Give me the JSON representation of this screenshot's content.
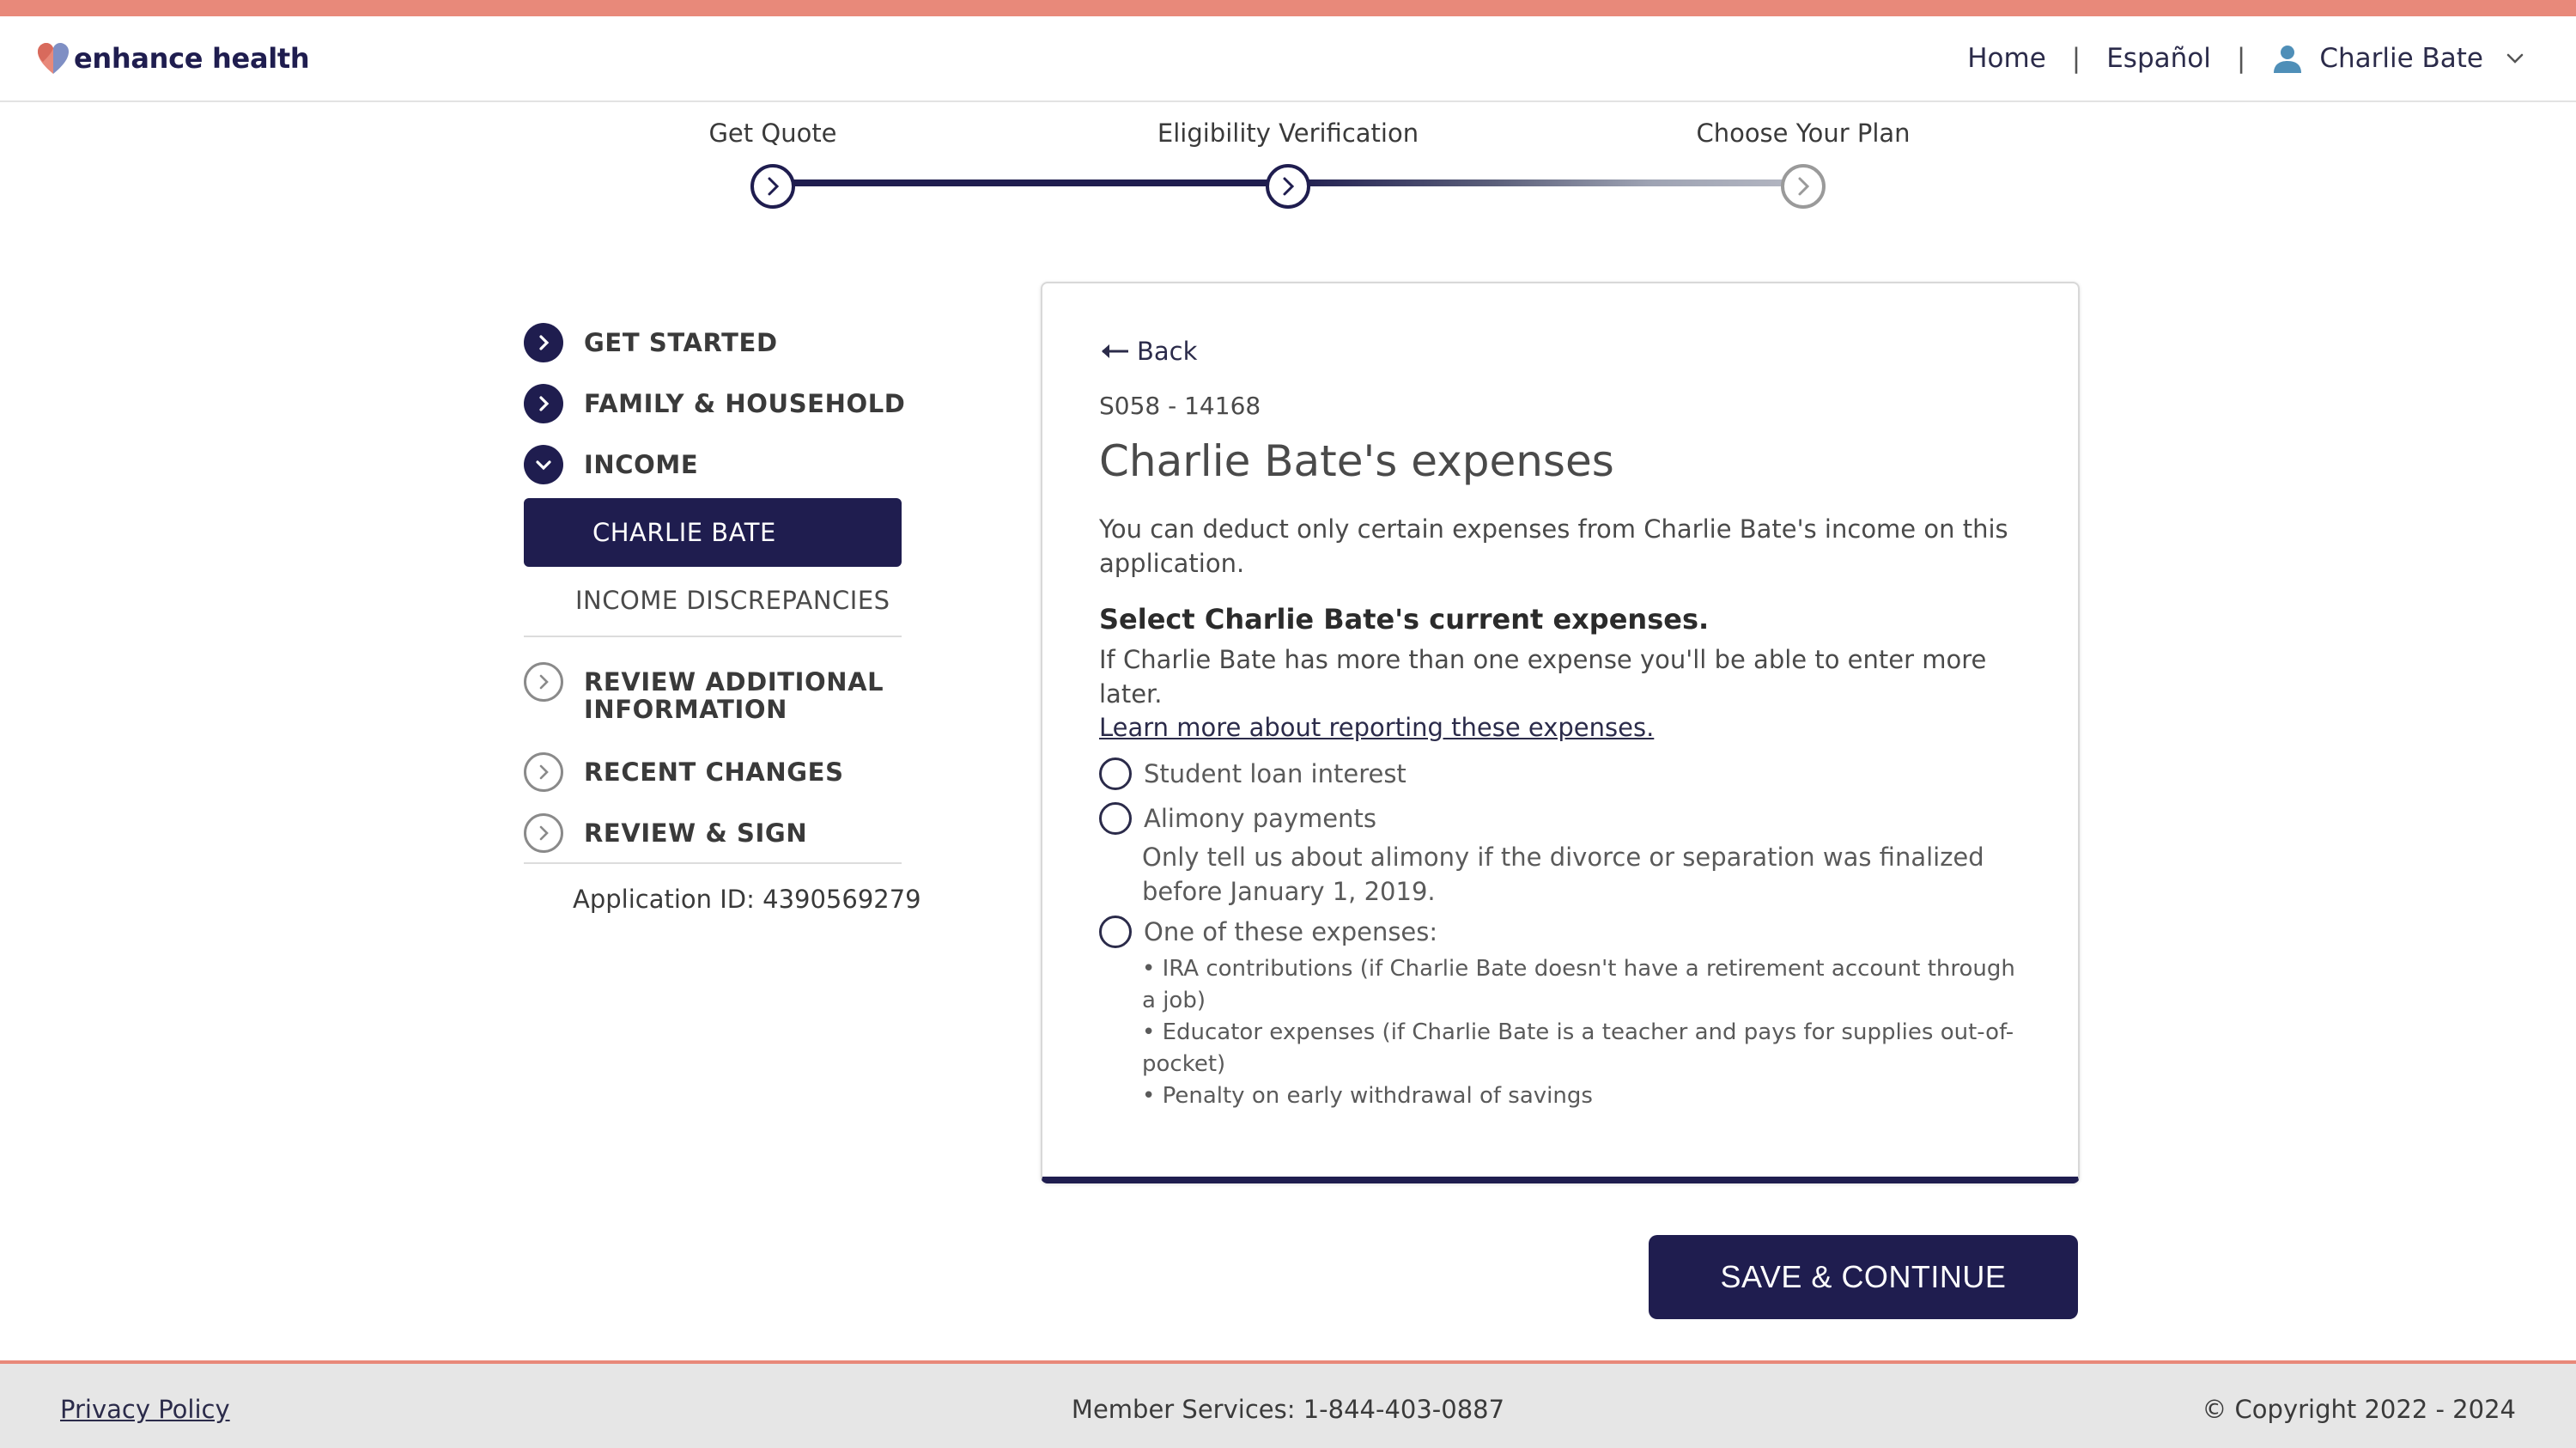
{
  "header": {
    "brand": "enhance health",
    "nav": {
      "home": "Home",
      "separator": "|",
      "language": "Español",
      "user_name": "Charlie Bate"
    }
  },
  "stepper": {
    "steps": [
      {
        "label": "Get Quote",
        "status": "complete"
      },
      {
        "label": "Eligibility Verification",
        "status": "current"
      },
      {
        "label": "Choose Your Plan",
        "status": "upcoming"
      }
    ]
  },
  "sidebar": {
    "items": [
      {
        "label": "GET STARTED",
        "icon": "chevron-right-filled-icon"
      },
      {
        "label": "FAMILY & HOUSEHOLD",
        "icon": "chevron-right-filled-icon"
      },
      {
        "label": "INCOME",
        "icon": "chevron-down-filled-icon"
      },
      {
        "label": "REVIEW ADDITIONAL INFORMATION",
        "icon": "chevron-right-outline-icon"
      },
      {
        "label": "RECENT CHANGES",
        "icon": "chevron-right-outline-icon"
      },
      {
        "label": "REVIEW & SIGN",
        "icon": "chevron-right-outline-icon"
      }
    ],
    "income_sub": {
      "active": "CHARLIE BATE",
      "other": "INCOME DISCREPANCIES"
    },
    "application_id": "Application ID: 4390569279"
  },
  "card": {
    "back": "Back",
    "code": "S058 - 14168",
    "title": "Charlie Bate's expenses",
    "intro": "You can deduct only certain expenses from Charlie Bate's income on this application.",
    "question": "Select Charlie Bate's current expenses.",
    "help": "If Charlie Bate has more than one expense you'll be able to enter more later.",
    "learn_more": "Learn more about reporting these expenses.",
    "options": [
      {
        "label": "Student loan interest",
        "checked": false
      },
      {
        "label": "Alimony payments",
        "checked": false,
        "note": "Only tell us about alimony if the divorce or separation was finalized before January 1, 2019."
      },
      {
        "label": "One of these expenses:",
        "checked": false,
        "bullets": [
          "• IRA contributions (if Charlie Bate doesn't have a retirement account through a job)",
          "• Educator expenses (if Charlie Bate is a teacher and pays for supplies out-of-pocket)",
          "• Penalty on early withdrawal of savings"
        ]
      }
    ]
  },
  "actions": {
    "save_continue": "SAVE & CONTINUE"
  },
  "footer": {
    "privacy": "Privacy Policy",
    "member_services": "Member Services: 1-844-403-0887",
    "copyright": "© Copyright 2022 - 2024"
  },
  "colors": {
    "accent": "#e8897a",
    "navy": "#1f1d4f",
    "footer_bg": "#e6e6e6"
  }
}
